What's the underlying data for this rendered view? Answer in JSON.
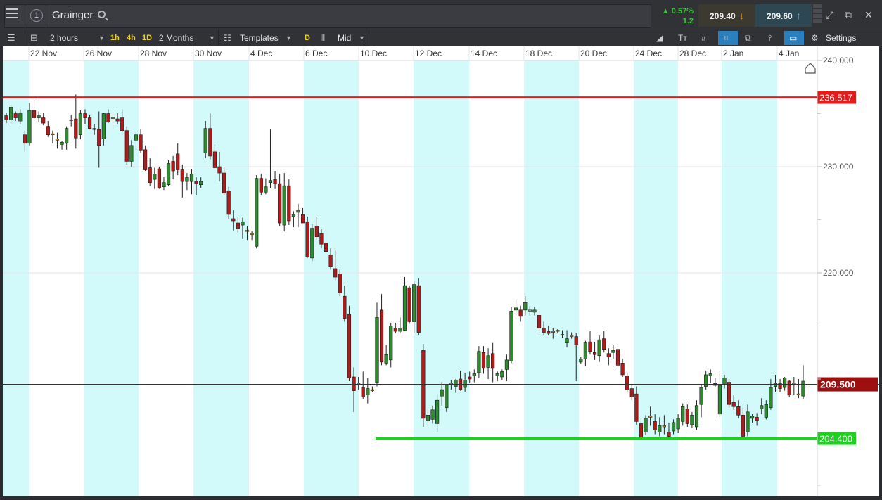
{
  "header": {
    "title": "Grainger",
    "instrument_number": "1",
    "change_pct": "▲ 0.57%",
    "change_abs": "1.2",
    "sell_price": "209.40",
    "buy_price": "209.60"
  },
  "toolbar": {
    "interval": "2 hours",
    "quick_intervals": [
      "1h",
      "4h",
      "1D"
    ],
    "range": "2 Months",
    "templates_label": "Templates",
    "draw_label": "D",
    "price_type": "Mid",
    "settings_label": "Settings"
  },
  "colors": {
    "bull": "#2f8a2f",
    "bear": "#b31b1b",
    "band": "#d3fafa",
    "resistance": "#e41b1b",
    "support": "#1fd11f",
    "current_price_bg": "#9e0f0f"
  },
  "chart_data": {
    "type": "candlestick",
    "x_tick_labels": [
      "22 Nov",
      "26 Nov",
      "28 Nov",
      "30 Nov",
      "4 Dec",
      "6 Dec",
      "10 Dec",
      "12 Dec",
      "14 Dec",
      "18 Dec",
      "20 Dec",
      "24 Dec",
      "28 Dec",
      "2 Jan",
      "4 Jan"
    ],
    "y_ticks": [
      "240.000",
      "230.000",
      "220.000"
    ],
    "ylim": [
      198.5,
      240.0
    ],
    "resistance_level": "236.517",
    "support_level": "204.400",
    "current_price": "209.500",
    "candles": [
      [
        234.8,
        235.1,
        234.1,
        234.4
      ],
      [
        234.4,
        235.8,
        234.0,
        235.6
      ],
      [
        235.0,
        235.2,
        234.3,
        234.6
      ],
      [
        234.3,
        235.4,
        234.0,
        235.0
      ],
      [
        233.0,
        233.4,
        231.4,
        232.2
      ],
      [
        232.2,
        236.0,
        232.0,
        235.3
      ],
      [
        235.3,
        236.3,
        234.5,
        234.6
      ],
      [
        234.6,
        235.2,
        234.2,
        234.8
      ],
      [
        234.6,
        235.1,
        233.9,
        234.1
      ],
      [
        233.8,
        234.3,
        232.8,
        233.0
      ],
      [
        233.0,
        233.4,
        232.2,
        233.1
      ],
      [
        232.6,
        233.2,
        231.7,
        232.5
      ],
      [
        232.1,
        232.4,
        231.6,
        232.3
      ],
      [
        232.2,
        233.8,
        231.6,
        233.6
      ],
      [
        234.4,
        234.9,
        233.8,
        234.4
      ],
      [
        234.5,
        236.8,
        231.7,
        232.7
      ],
      [
        233.0,
        235.3,
        232.6,
        235.0
      ],
      [
        235.0,
        235.4,
        234.0,
        234.6
      ],
      [
        234.6,
        234.9,
        233.5,
        233.6
      ],
      [
        233.6,
        234.0,
        233.0,
        233.5
      ],
      [
        233.5,
        235.2,
        229.9,
        232.0
      ],
      [
        232.6,
        235.1,
        232.0,
        235.0
      ],
      [
        235.0,
        235.4,
        234.1,
        234.2
      ],
      [
        234.6,
        235.2,
        233.8,
        234.6
      ],
      [
        234.5,
        235.1,
        234.0,
        234.3
      ],
      [
        234.6,
        235.4,
        233.2,
        233.4
      ],
      [
        233.4,
        233.8,
        230.2,
        230.5
      ],
      [
        230.5,
        232.5,
        230.0,
        232.0
      ],
      [
        232.5,
        233.3,
        231.6,
        233.0
      ],
      [
        233.0,
        233.5,
        231.3,
        231.5
      ],
      [
        231.6,
        232.0,
        229.6,
        229.7
      ],
      [
        229.9,
        230.8,
        228.2,
        228.5
      ],
      [
        228.8,
        229.9,
        227.9,
        229.3
      ],
      [
        229.8,
        230.0,
        227.9,
        228.0
      ],
      [
        228.1,
        229.0,
        227.8,
        228.5
      ],
      [
        228.3,
        230.6,
        228.2,
        230.3
      ],
      [
        230.5,
        231.0,
        228.8,
        229.6
      ],
      [
        231.2,
        232.2,
        229.2,
        229.7
      ],
      [
        229.7,
        230.2,
        227.1,
        228.6
      ],
      [
        228.6,
        229.4,
        227.8,
        229.0
      ],
      [
        228.6,
        229.8,
        227.4,
        229.3
      ],
      [
        228.6,
        229.0,
        227.3,
        228.4
      ],
      [
        228.3,
        229.0,
        228.0,
        228.6
      ],
      [
        231.3,
        234.3,
        230.8,
        233.6
      ],
      [
        233.6,
        235.0,
        230.7,
        231.0
      ],
      [
        231.4,
        232.1,
        229.8,
        229.9
      ],
      [
        230.0,
        231.4,
        228.6,
        229.4
      ],
      [
        229.4,
        230.0,
        227.3,
        227.5
      ],
      [
        227.7,
        228.1,
        225.1,
        225.5
      ],
      [
        225.1,
        225.9,
        224.0,
        224.9
      ],
      [
        224.7,
        225.3,
        223.8,
        224.2
      ],
      [
        224.5,
        225.2,
        223.2,
        224.8
      ],
      [
        224.0,
        224.4,
        223.1,
        223.9
      ],
      [
        223.6,
        223.9,
        223.1,
        223.7
      ],
      [
        222.5,
        229.2,
        222.3,
        228.9
      ],
      [
        228.9,
        229.3,
        227.3,
        227.6
      ],
      [
        227.6,
        228.9,
        227.4,
        228.1
      ],
      [
        228.5,
        233.5,
        228.0,
        228.7
      ],
      [
        228.8,
        229.6,
        227.9,
        228.4
      ],
      [
        228.4,
        229.3,
        224.4,
        224.7
      ],
      [
        224.5,
        229.4,
        223.9,
        228.2
      ],
      [
        228.2,
        228.8,
        224.5,
        224.9
      ],
      [
        225.3,
        225.8,
        224.3,
        225.5
      ],
      [
        225.7,
        226.5,
        224.3,
        225.9
      ],
      [
        225.5,
        226.1,
        224.7,
        224.7
      ],
      [
        224.8,
        225.3,
        221.4,
        221.5
      ],
      [
        221.4,
        224.6,
        221.1,
        224.2
      ],
      [
        224.4,
        225.3,
        223.1,
        223.4
      ],
      [
        223.7,
        224.1,
        222.3,
        222.7
      ],
      [
        222.8,
        223.8,
        221.9,
        222.0
      ],
      [
        221.7,
        222.3,
        220.3,
        220.6
      ],
      [
        220.4,
        222.1,
        219.3,
        219.6
      ],
      [
        219.9,
        220.3,
        217.8,
        218.1
      ],
      [
        217.8,
        218.8,
        215.4,
        215.7
      ],
      [
        216.1,
        216.9,
        209.8,
        210.1
      ],
      [
        210.2,
        211.1,
        206.9,
        208.9
      ],
      [
        209.6,
        210.2,
        209.0,
        209.5
      ],
      [
        209.2,
        210.7,
        208.1,
        208.3
      ],
      [
        208.5,
        210.1,
        207.7,
        209.1
      ],
      [
        209.0,
        209.3,
        208.8,
        208.9
      ],
      [
        209.7,
        217.2,
        209.3,
        215.8
      ],
      [
        216.5,
        218.0,
        211.3,
        211.6
      ],
      [
        211.5,
        213.2,
        211.3,
        212.3
      ],
      [
        211.8,
        215.3,
        211.1,
        215.0
      ],
      [
        214.8,
        215.3,
        214.3,
        214.5
      ],
      [
        214.5,
        215.8,
        214.3,
        214.8
      ],
      [
        214.6,
        219.6,
        214.5,
        218.8
      ],
      [
        218.6,
        218.8,
        215.2,
        215.4
      ],
      [
        215.4,
        219.2,
        214.3,
        218.9
      ],
      [
        218.8,
        219.5,
        214.1,
        214.4
      ],
      [
        212.7,
        213.3,
        205.5,
        206.3
      ],
      [
        206.1,
        207.2,
        205.6,
        206.6
      ],
      [
        206.2,
        207.5,
        205.8,
        207.1
      ],
      [
        205.8,
        208.6,
        205.0,
        208.0
      ],
      [
        208.4,
        209.7,
        207.5,
        209.0
      ],
      [
        207.3,
        209.5,
        206.9,
        209.5
      ],
      [
        209.5,
        209.9,
        209.0,
        209.6
      ],
      [
        209.3,
        210.0,
        208.7,
        209.9
      ],
      [
        210.0,
        210.8,
        208.9,
        209.0
      ],
      [
        209.2,
        210.6,
        208.8,
        209.9
      ],
      [
        210.2,
        210.7,
        209.6,
        210.0
      ],
      [
        210.3,
        210.9,
        209.7,
        210.5
      ],
      [
        210.6,
        213.1,
        210.1,
        212.6
      ],
      [
        212.5,
        213.1,
        210.5,
        211.0
      ],
      [
        211.1,
        212.9,
        210.0,
        212.2
      ],
      [
        212.4,
        213.4,
        209.7,
        211.0
      ],
      [
        210.3,
        210.7,
        209.8,
        210.5
      ],
      [
        210.2,
        210.9,
        209.9,
        210.7
      ],
      [
        210.9,
        212.3,
        209.8,
        211.8
      ],
      [
        211.7,
        216.8,
        211.5,
        216.4
      ],
      [
        216.5,
        217.6,
        216.0,
        216.7
      ],
      [
        216.5,
        216.9,
        215.4,
        215.9
      ],
      [
        216.5,
        217.8,
        216.0,
        217.2
      ],
      [
        216.4,
        216.9,
        216.0,
        216.5
      ],
      [
        216.3,
        216.8,
        216.0,
        216.5
      ],
      [
        216.0,
        216.4,
        214.4,
        214.8
      ],
      [
        214.8,
        215.4,
        214.1,
        214.4
      ],
      [
        214.5,
        215.0,
        214.1,
        214.3
      ],
      [
        214.4,
        214.8,
        213.8,
        214.5
      ],
      [
        214.5,
        214.7,
        214.3,
        214.6
      ],
      [
        214.2,
        214.6,
        213.9,
        214.2
      ],
      [
        213.4,
        214.6,
        213.0,
        213.8
      ],
      [
        214.0,
        214.4,
        213.8,
        214.1
      ],
      [
        214.0,
        214.3,
        209.8,
        213.2
      ],
      [
        211.6,
        212.1,
        211.4,
        211.9
      ],
      [
        211.9,
        213.6,
        211.2,
        213.4
      ],
      [
        213.5,
        214.5,
        212.3,
        212.6
      ],
      [
        212.5,
        213.5,
        211.8,
        212.3
      ],
      [
        212.2,
        214.1,
        211.6,
        213.7
      ],
      [
        213.8,
        214.5,
        212.5,
        212.8
      ],
      [
        212.4,
        212.9,
        211.3,
        212.1
      ],
      [
        212.5,
        213.2,
        211.9,
        212.7
      ],
      [
        212.8,
        213.3,
        211.0,
        211.3
      ],
      [
        211.5,
        211.9,
        210.2,
        210.4
      ],
      [
        210.3,
        210.6,
        208.8,
        209.0
      ],
      [
        209.1,
        209.4,
        208.0,
        208.3
      ],
      [
        208.6,
        209.3,
        205.7,
        206.0
      ],
      [
        205.8,
        206.3,
        204.4,
        204.5
      ],
      [
        205.0,
        206.6,
        204.7,
        206.3
      ],
      [
        206.4,
        207.4,
        205.6,
        206.5
      ],
      [
        206.0,
        206.7,
        204.8,
        205.2
      ],
      [
        205.0,
        206.4,
        204.6,
        205.6
      ],
      [
        205.6,
        206.6,
        204.8,
        205.5
      ],
      [
        205.0,
        205.9,
        204.4,
        204.6
      ],
      [
        205.1,
        206.2,
        204.8,
        205.9
      ],
      [
        205.3,
        206.7,
        204.9,
        206.3
      ],
      [
        206.0,
        207.7,
        205.6,
        207.4
      ],
      [
        207.2,
        207.6,
        205.5,
        205.8
      ],
      [
        205.7,
        206.9,
        205.4,
        206.6
      ],
      [
        205.5,
        208.0,
        205.2,
        207.5
      ],
      [
        207.6,
        209.5,
        206.4,
        209.2
      ],
      [
        209.3,
        210.8,
        209.0,
        210.4
      ],
      [
        210.3,
        210.9,
        209.6,
        210.5
      ],
      [
        209.6,
        210.1,
        209.2,
        209.4
      ],
      [
        206.7,
        210.5,
        206.4,
        209.4
      ],
      [
        209.5,
        210.4,
        209.1,
        210.1
      ],
      [
        209.7,
        210.0,
        207.3,
        207.6
      ],
      [
        207.8,
        208.5,
        207.1,
        207.4
      ],
      [
        207.4,
        208.0,
        206.3,
        206.6
      ],
      [
        206.6,
        207.3,
        204.5,
        204.6
      ],
      [
        205.0,
        207.6,
        204.6,
        206.9
      ],
      [
        206.3,
        206.7,
        205.9,
        206.5
      ],
      [
        206.4,
        206.8,
        205.6,
        206.1
      ],
      [
        207.2,
        208.2,
        206.7,
        207.5
      ],
      [
        206.4,
        208.0,
        206.2,
        207.6
      ],
      [
        207.3,
        210.0,
        207.1,
        209.2
      ],
      [
        209.3,
        210.4,
        208.8,
        209.6
      ],
      [
        209.6,
        210.0,
        208.8,
        209.1
      ],
      [
        209.2,
        210.2,
        208.9,
        210.1
      ],
      [
        209.8,
        209.9,
        208.3,
        208.5
      ],
      [
        209.6,
        210.2,
        208.5,
        209.5
      ],
      [
        208.5,
        210.0,
        208.2,
        208.6
      ],
      [
        208.4,
        211.3,
        208.1,
        209.8
      ]
    ]
  }
}
